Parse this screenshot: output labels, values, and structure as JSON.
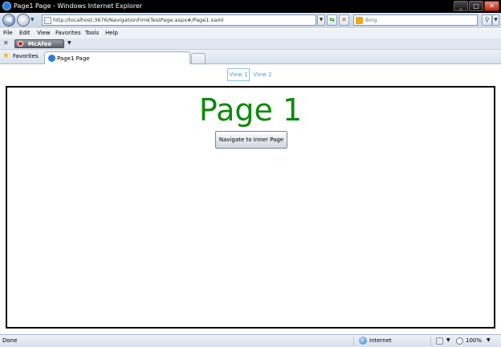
{
  "window": {
    "title": "Page1 Page - Windows Internet Explorer"
  },
  "address_bar": {
    "url": "http://localhost:3676/NavigationFrmkTestPage.aspx#/Page1.xaml"
  },
  "search": {
    "placeholder": "Bing"
  },
  "menu": [
    "File",
    "Edit",
    "View",
    "Favorites",
    "Tools",
    "Help"
  ],
  "toolbar": {
    "mcafee_label": "McAfee"
  },
  "favorites_bar": {
    "favorites_label": "Favorites",
    "active_tab_label": "Page1 Page"
  },
  "page": {
    "view_tabs": [
      "View 1",
      "View 2"
    ],
    "selected_view": "View 1",
    "heading": "Page 1",
    "button_label": "Navigate to Inner Page"
  },
  "status_bar": {
    "status": "Done",
    "zone": "Internet",
    "zoom": "100%"
  },
  "colors": {
    "heading": "#0b8a0b",
    "view_tab_text": "#5aa0d6",
    "title_bar": "#000000"
  },
  "icons": [
    "ie-icon",
    "back-arrow-icon",
    "forward-arrow-icon",
    "page-icon",
    "refresh-icon",
    "stop-icon",
    "bing-icon",
    "search-icon",
    "star-icon",
    "mcafee-icon",
    "globe-icon",
    "protected-mode-icon",
    "zoom-icon"
  ]
}
